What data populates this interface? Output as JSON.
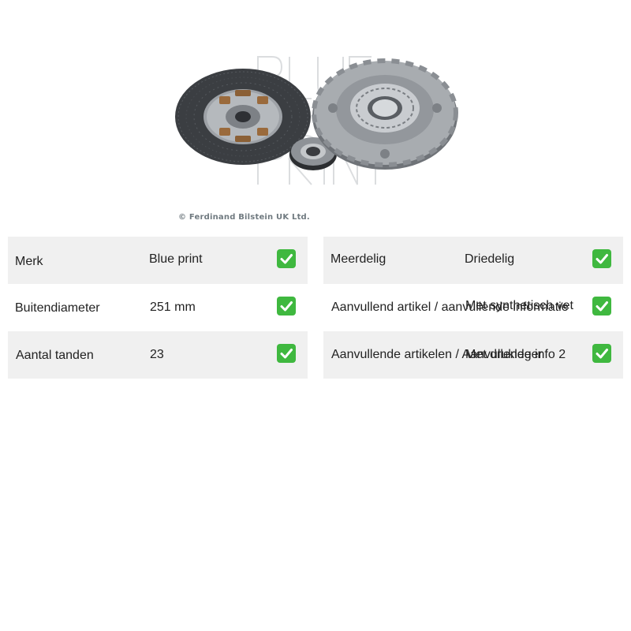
{
  "image": {
    "watermark_logo": "BLUE PRINT",
    "copyright": "© Ferdinand Bilstein UK Ltd."
  },
  "colors": {
    "row_shade": "#f0f0f0",
    "check_green": "#3fb83f",
    "text": "#222222"
  },
  "specs_left": [
    {
      "key": "Merk",
      "value": "Blue print",
      "status_icon": "check-mark-icon"
    },
    {
      "key": "Buitendiameter",
      "value": "251 mm",
      "status_icon": "check-mark-icon"
    },
    {
      "key": "Aantal tanden",
      "value": "23",
      "status_icon": "check-mark-icon"
    }
  ],
  "specs_right": [
    {
      "key": "Meerdelig",
      "value": "Driedelig",
      "status_icon": "check-mark-icon"
    },
    {
      "key": "Aanvullend artikel / aanvullende informatie",
      "value": "Met synthetisch vet",
      "status_icon": "check-mark-icon"
    },
    {
      "key": "Aanvullende artikelen / Aanvullende info 2",
      "value": "Met drukleger",
      "status_icon": "check-mark-icon"
    }
  ]
}
